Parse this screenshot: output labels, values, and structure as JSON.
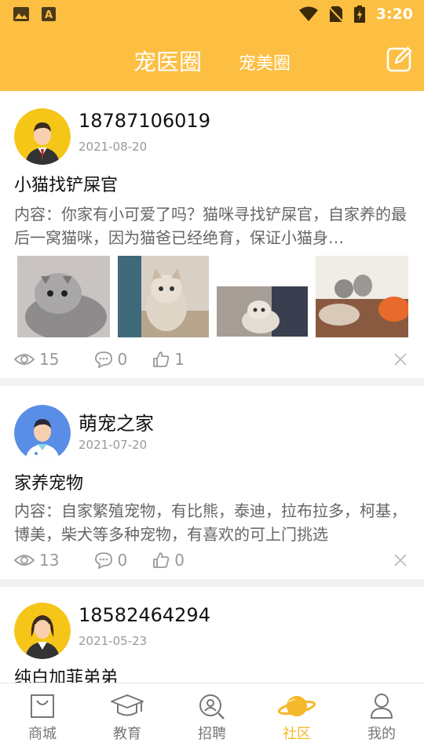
{
  "status_bar": {
    "time": "3:20"
  },
  "header": {
    "tab_active": "宠医圈",
    "tab_other": "宠美圈"
  },
  "posts": [
    {
      "user": "18787106019",
      "date": "2021-08-20",
      "title": "小猫找铲屎官",
      "content": "内容：你家有小可爱了吗？猫咪寻找铲屎官，自家养的最后一窝猫咪，因为猫爸已经绝育，保证小猫身…",
      "views": "15",
      "comments": "0",
      "likes": "1"
    },
    {
      "user": "萌宠之家",
      "date": "2021-07-20",
      "title": "家养宠物",
      "content": "内容：自家繁殖宠物，有比熊，泰迪，拉布拉多，柯基，博美，柴犬等多种宠物，有喜欢的可上门挑选",
      "views": "13",
      "comments": "0",
      "likes": "0"
    },
    {
      "user": "18582464294",
      "date": "2021-05-23",
      "title": "纯白加菲弟弟"
    }
  ],
  "bottom_nav": [
    {
      "label": "商城",
      "icon": "shop-bag-icon"
    },
    {
      "label": "教育",
      "icon": "graduation-cap-icon"
    },
    {
      "label": "招聘",
      "icon": "recruit-search-icon"
    },
    {
      "label": "社区",
      "icon": "planet-icon",
      "active": true
    },
    {
      "label": "我的",
      "icon": "user-icon"
    }
  ],
  "colors": {
    "brand": "#fcbf42",
    "active_nav": "#f5b82a"
  }
}
